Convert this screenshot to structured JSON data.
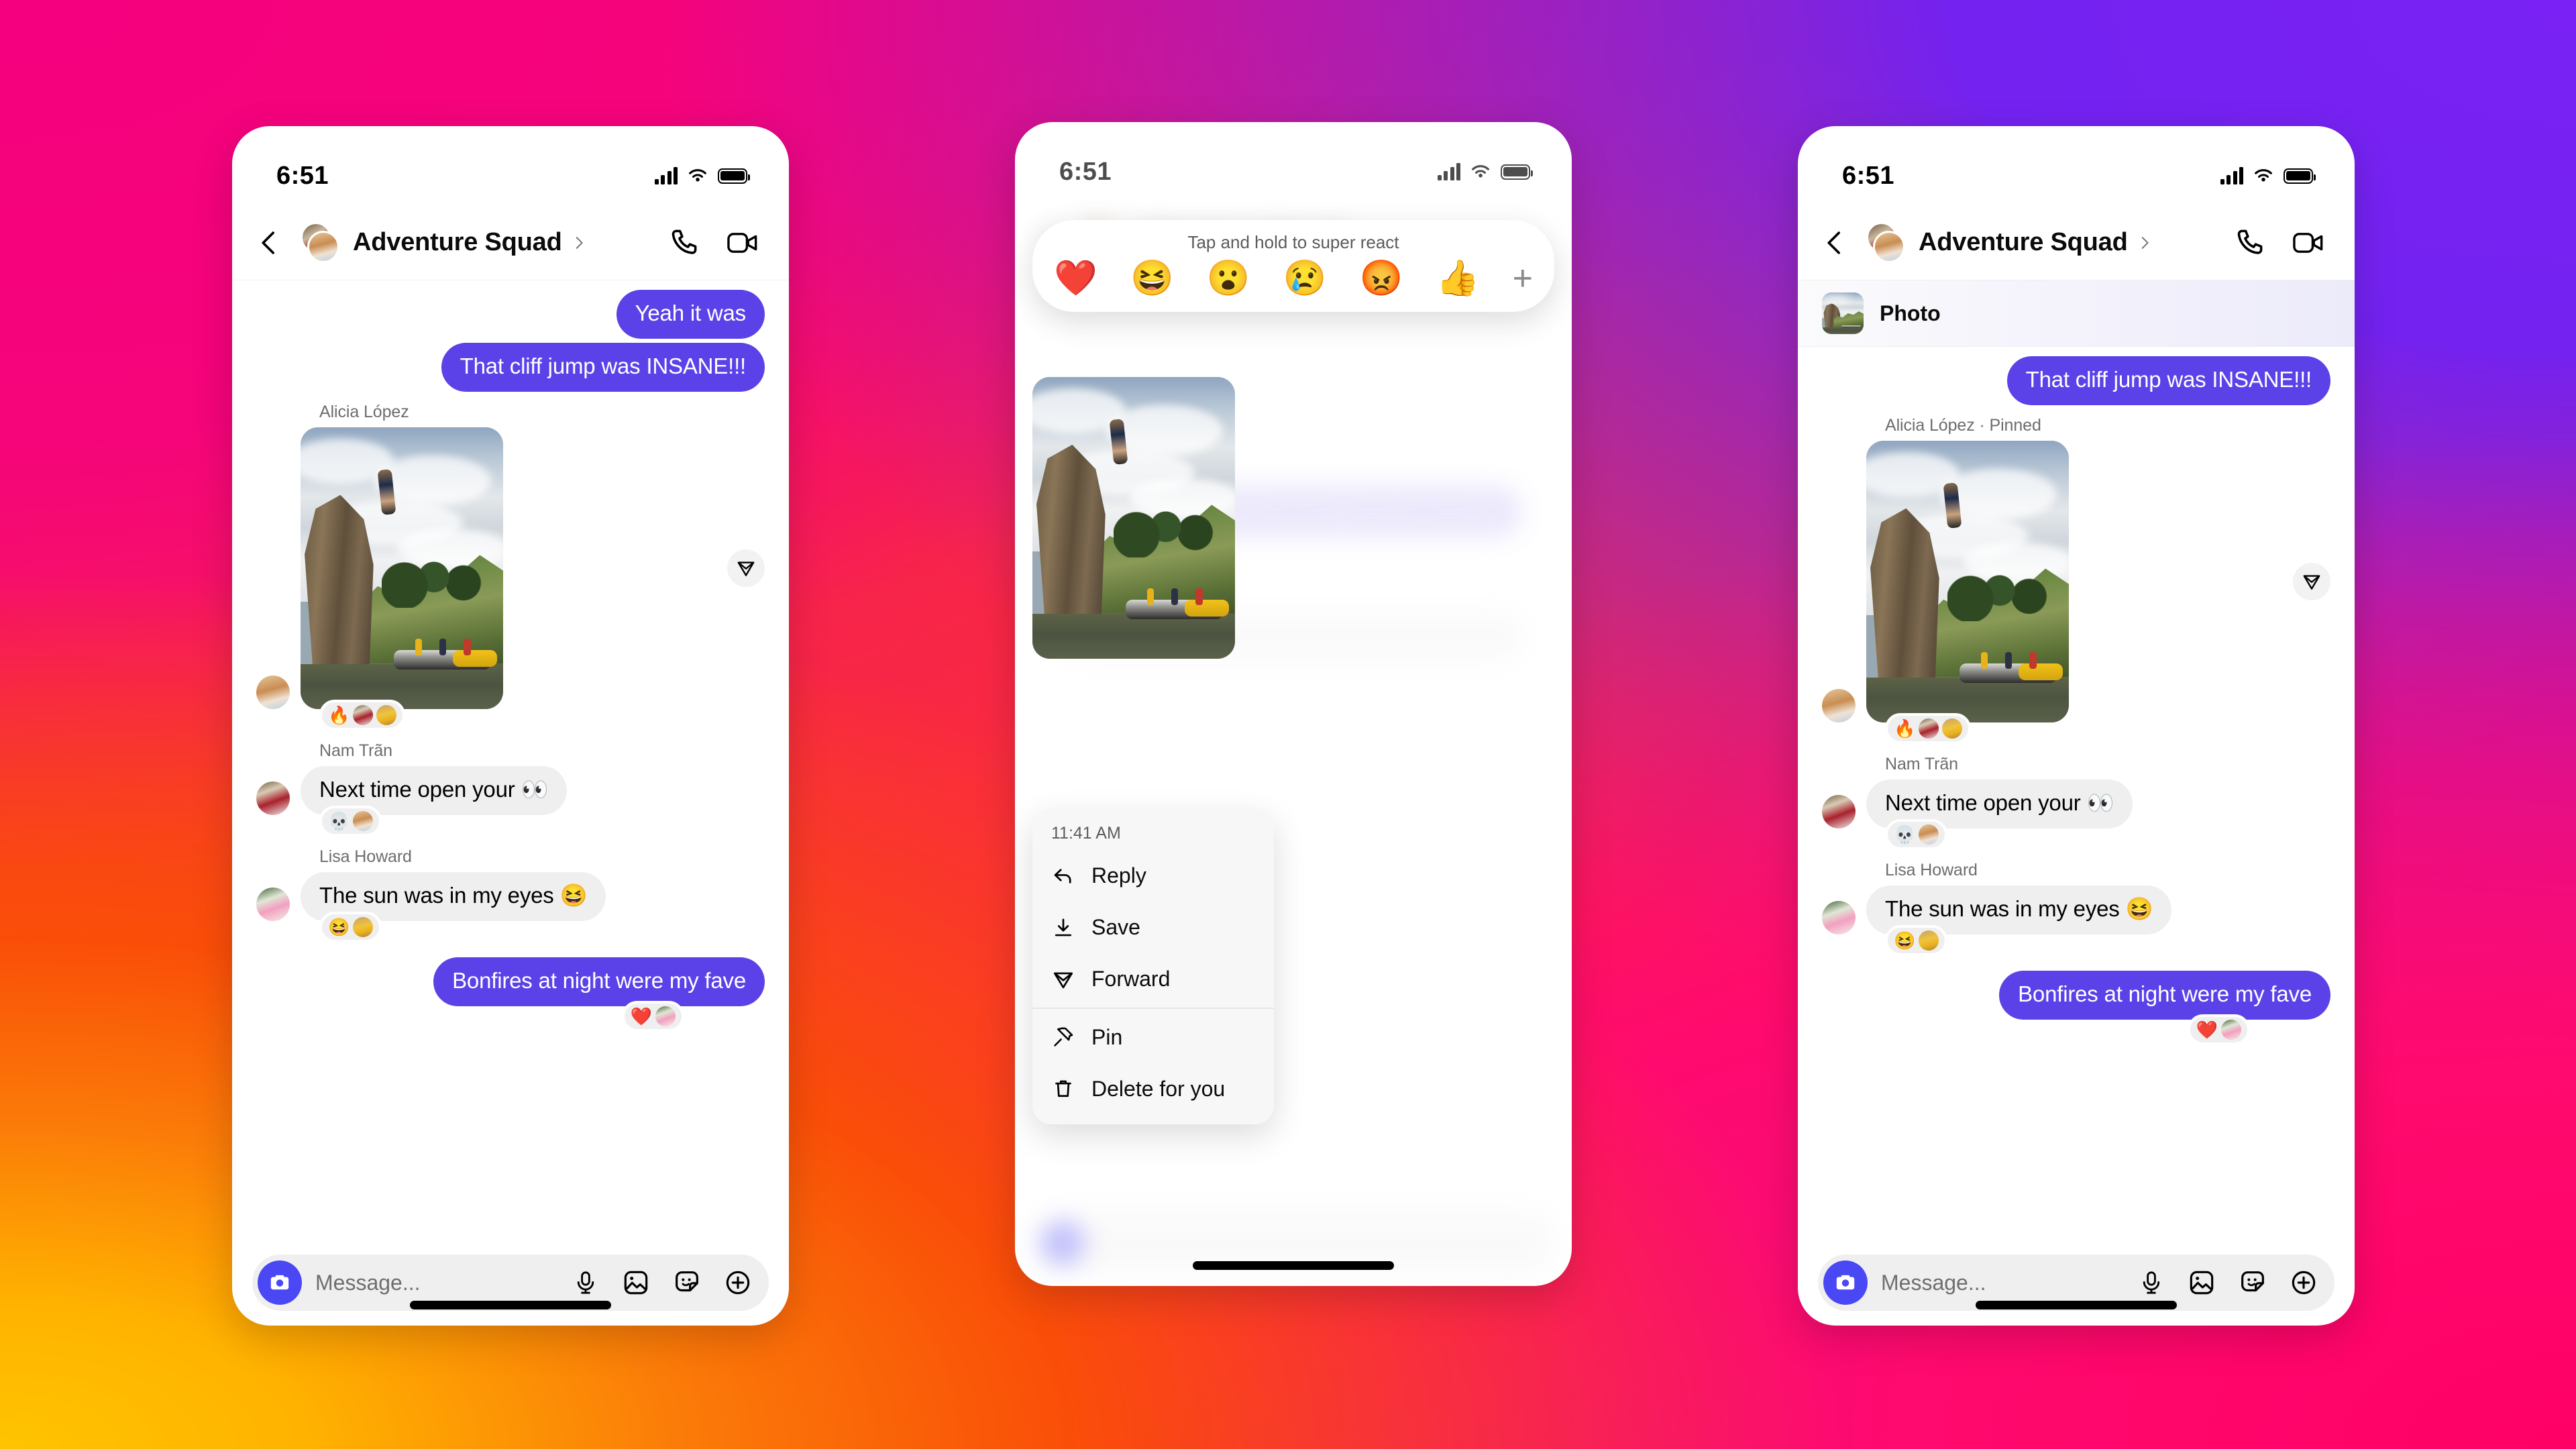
{
  "meta": {
    "scene": "Instagram direct message thread shown on three phone mockups over a pink-orange-purple gradient",
    "background_colors": {
      "top_left": "#f50a78",
      "top_right": "#7a22f5",
      "bottom_left": "#ffc400",
      "bottom_right": "#ff0066",
      "mid_left_orange": "#fa4e08"
    },
    "accent_bubble": "#5b42e8",
    "camera_button": "#4a47f5"
  },
  "status_bar": {
    "time": "6:51",
    "cellular_icon": "signal-bars-icon",
    "wifi_icon": "wifi-icon",
    "battery_icon": "battery-full-icon"
  },
  "header": {
    "back_icon": "chevron-left-icon",
    "avatar_stack": "group-avatar",
    "title": "Adventure Squad",
    "title_chevron_icon": "chevron-right-icon",
    "call_icon": "phone-call-icon",
    "video_icon": "video-camera-icon"
  },
  "composer": {
    "camera_icon": "camera-icon",
    "placeholder": "Message...",
    "mic_icon": "microphone-icon",
    "gallery_icon": "image-icon",
    "sticker_icon": "sticker-icon",
    "plus_icon": "plus-circle-icon"
  },
  "phone1": {
    "label": "Chat thread default state",
    "messages": [
      {
        "id": "m1",
        "side": "out",
        "text": "Yeah it was"
      },
      {
        "id": "m2",
        "side": "out",
        "text": "That cliff jump was INSANE!!!"
      },
      {
        "id": "m3",
        "side": "in",
        "sender": "Alicia López",
        "type": "photo",
        "forward_icon": "forward-paper-plane-icon",
        "reactions": [
          "🔥"
        ],
        "reactors": [
          "nam",
          "yellow"
        ]
      },
      {
        "id": "m4",
        "side": "in",
        "sender": "Nam Trãn",
        "text": "Next time open your 👀",
        "reactions": [
          "💀"
        ],
        "reactors": [
          "alicia"
        ]
      },
      {
        "id": "m5",
        "side": "in",
        "sender": "Lisa Howard",
        "text": "The sun was in my eyes 😆",
        "reactions": [
          "😆"
        ],
        "reactors": [
          "yellow"
        ]
      },
      {
        "id": "m6",
        "side": "out",
        "text": "Bonfires at night were my fave",
        "reactions": [
          "❤️"
        ],
        "reactors": [
          "lisa"
        ]
      }
    ]
  },
  "phone2": {
    "label": "Long-press message action state",
    "react_bar": {
      "hint": "Tap and hold to super react",
      "emojis": [
        "❤️",
        "😆",
        "😮",
        "😢",
        "😡",
        "👍"
      ],
      "add_icon": "plus-icon"
    },
    "context_menu": {
      "timestamp": "11:41 AM",
      "items": [
        {
          "label": "Reply",
          "icon": "reply-arrow-icon"
        },
        {
          "label": "Save",
          "icon": "download-icon"
        },
        {
          "label": "Forward",
          "icon": "forward-paper-plane-icon"
        },
        {
          "label": "Pin",
          "icon": "pin-icon"
        },
        {
          "label": "Delete for you",
          "icon": "trash-icon"
        }
      ]
    }
  },
  "phone3": {
    "label": "Chat thread with pinned photo banner",
    "pinned_banner": {
      "thumbnail_icon": "photo-thumbnail",
      "label": "Photo"
    },
    "messages": [
      {
        "id": "p3m1",
        "side": "out",
        "text": "That cliff jump was INSANE!!!"
      },
      {
        "id": "p3m2",
        "side": "in",
        "sender": "Alicia López · Pinned",
        "type": "photo",
        "forward_icon": "forward-paper-plane-icon",
        "reactions": [
          "🔥"
        ],
        "reactors": [
          "nam",
          "yellow"
        ]
      },
      {
        "id": "p3m3",
        "side": "in",
        "sender": "Nam Trãn",
        "text": "Next time open your 👀",
        "reactions": [
          "💀"
        ],
        "reactors": [
          "alicia"
        ]
      },
      {
        "id": "p3m4",
        "side": "in",
        "sender": "Lisa Howard",
        "text": "The sun was in my eyes 😆",
        "reactions": [
          "😆"
        ],
        "reactors": [
          "yellow"
        ]
      },
      {
        "id": "p3m5",
        "side": "out",
        "text": "Bonfires at night were my fave",
        "reactions": [
          "❤️"
        ],
        "reactors": [
          "lisa"
        ]
      }
    ]
  }
}
